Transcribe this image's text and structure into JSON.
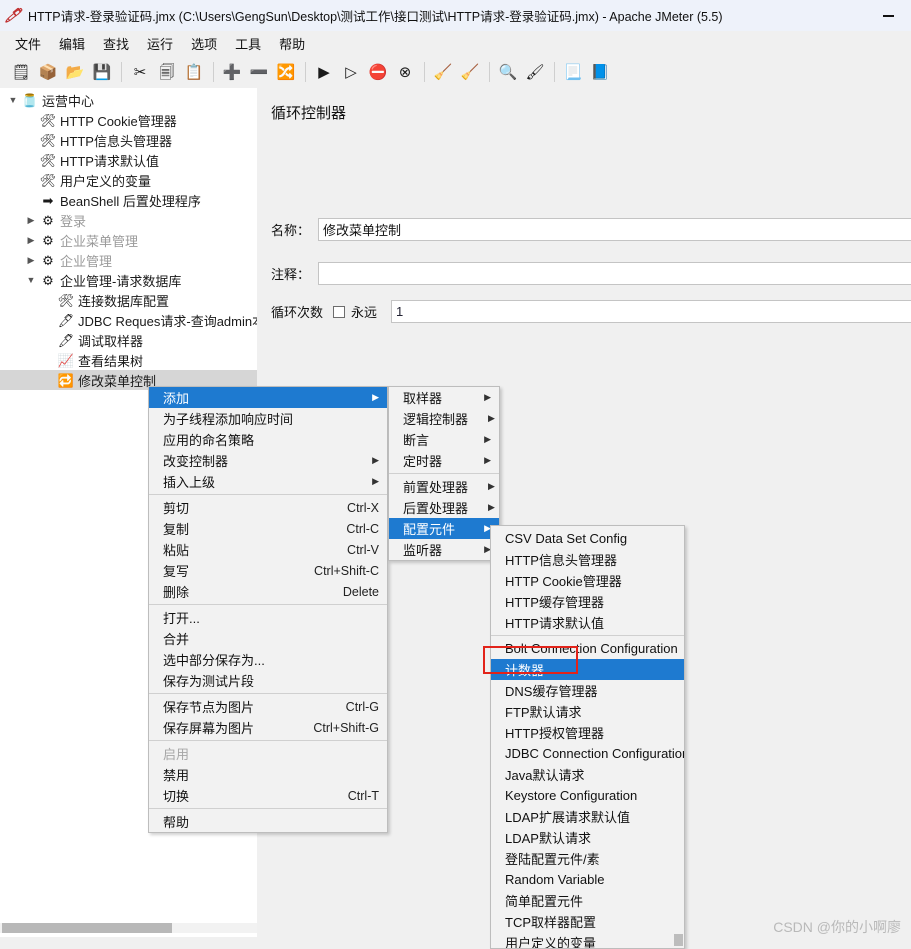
{
  "window": {
    "title": "HTTP请求-登录验证码.jmx (C:\\Users\\GengSun\\Desktop\\测试工作\\接口测试\\HTTP请求-登录验证码.jmx) - Apache JMeter (5.5)",
    "app_icon": "jmeter-feather-icon",
    "minimize_label": "—"
  },
  "menubar": {
    "items": [
      "文件",
      "编辑",
      "查找",
      "运行",
      "选项",
      "工具",
      "帮助"
    ]
  },
  "toolbar": {
    "buttons": [
      {
        "name": "new-test-plan",
        "glyph": "🗒"
      },
      {
        "name": "templates",
        "glyph": "📦"
      },
      {
        "name": "open",
        "glyph": "📂"
      },
      {
        "name": "save",
        "glyph": "💾"
      },
      {
        "sep": true
      },
      {
        "name": "cut",
        "glyph": "✂"
      },
      {
        "name": "copy",
        "glyph": "🗐"
      },
      {
        "name": "paste",
        "glyph": "📋"
      },
      {
        "sep": true
      },
      {
        "name": "expand-all",
        "glyph": "➕"
      },
      {
        "name": "collapse-all",
        "glyph": "➖"
      },
      {
        "name": "toggle",
        "glyph": "🔀"
      },
      {
        "sep": true
      },
      {
        "name": "start",
        "glyph": "▶"
      },
      {
        "name": "start-no-pauses",
        "glyph": "▷"
      },
      {
        "name": "stop",
        "glyph": "⛔"
      },
      {
        "name": "shutdown",
        "glyph": "⊗"
      },
      {
        "sep": true
      },
      {
        "name": "clear",
        "glyph": "🧹"
      },
      {
        "name": "clear-all",
        "glyph": "🧹"
      },
      {
        "sep": true
      },
      {
        "name": "search",
        "glyph": "🔍"
      },
      {
        "name": "reset-search",
        "glyph": "🖌"
      },
      {
        "sep": true
      },
      {
        "name": "function-helper",
        "glyph": "📃"
      },
      {
        "name": "help",
        "glyph": "📘"
      }
    ]
  },
  "tree": {
    "nodes": [
      {
        "label": "运营中心",
        "icon": "test-plan-icon",
        "indent": 0,
        "twist": "▼",
        "dim": false,
        "selected": false
      },
      {
        "label": "HTTP Cookie管理器",
        "icon": "config-element-icon",
        "indent": 1,
        "twist": "",
        "dim": false,
        "selected": false
      },
      {
        "label": "HTTP信息头管理器",
        "icon": "config-element-icon",
        "indent": 1,
        "twist": "",
        "dim": false,
        "selected": false
      },
      {
        "label": "HTTP请求默认值",
        "icon": "config-element-icon",
        "indent": 1,
        "twist": "",
        "dim": false,
        "selected": false
      },
      {
        "label": "用户定义的变量",
        "icon": "config-element-icon",
        "indent": 1,
        "twist": "",
        "dim": false,
        "selected": false
      },
      {
        "label": "BeanShell 后置处理程序",
        "icon": "post-processor-icon",
        "indent": 1,
        "twist": "",
        "dim": false,
        "selected": false
      },
      {
        "label": "登录",
        "icon": "controller-icon",
        "indent": 1,
        "twist": "▶",
        "dim": true,
        "selected": false
      },
      {
        "label": "企业菜单管理",
        "icon": "controller-icon",
        "indent": 1,
        "twist": "▶",
        "dim": true,
        "selected": false
      },
      {
        "label": "企业管理",
        "icon": "controller-icon",
        "indent": 1,
        "twist": "▶",
        "dim": true,
        "selected": false
      },
      {
        "label": "企业管理-请求数据库",
        "icon": "controller-active-icon",
        "indent": 1,
        "twist": "▼",
        "dim": false,
        "selected": false
      },
      {
        "label": "连接数据库配置",
        "icon": "config-element-icon",
        "indent": 2,
        "twist": "",
        "dim": false,
        "selected": false
      },
      {
        "label": "JDBC Reques请求-查询admin本|",
        "icon": "sampler-icon",
        "indent": 2,
        "twist": "",
        "dim": false,
        "selected": false
      },
      {
        "label": "调试取样器",
        "icon": "sampler-icon",
        "indent": 2,
        "twist": "",
        "dim": false,
        "selected": false
      },
      {
        "label": "查看结果树",
        "icon": "listener-icon",
        "indent": 2,
        "twist": "",
        "dim": false,
        "selected": false
      },
      {
        "label": "修改菜单控制",
        "icon": "loop-controller-icon",
        "indent": 2,
        "twist": "",
        "dim": false,
        "selected": true
      }
    ]
  },
  "detail": {
    "title": "循环控制器",
    "name_label": "名称：",
    "name_value": "修改菜单控制",
    "comment_label": "注释：",
    "comment_value": "",
    "loop_label": "循环次数",
    "forever_label": "永远",
    "forever_checked": false,
    "loop_value": "1"
  },
  "context_menu": {
    "items": [
      {
        "label": "添加",
        "accel": "",
        "arrow": true,
        "highlight": true,
        "disabled": false
      },
      {
        "label": "为子线程添加响应时间",
        "accel": "",
        "arrow": false,
        "highlight": false,
        "disabled": false
      },
      {
        "label": "应用的命名策略",
        "accel": "",
        "arrow": false,
        "highlight": false,
        "disabled": false
      },
      {
        "label": "改变控制器",
        "accel": "",
        "arrow": true,
        "highlight": false,
        "disabled": false
      },
      {
        "label": "插入上级",
        "accel": "",
        "arrow": true,
        "highlight": false,
        "disabled": false
      },
      {
        "sep": true
      },
      {
        "label": "剪切",
        "accel": "Ctrl-X",
        "arrow": false,
        "highlight": false,
        "disabled": false
      },
      {
        "label": "复制",
        "accel": "Ctrl-C",
        "arrow": false,
        "highlight": false,
        "disabled": false
      },
      {
        "label": "粘贴",
        "accel": "Ctrl-V",
        "arrow": false,
        "highlight": false,
        "disabled": false
      },
      {
        "label": "复写",
        "accel": "Ctrl+Shift-C",
        "arrow": false,
        "highlight": false,
        "disabled": false
      },
      {
        "label": "删除",
        "accel": "Delete",
        "arrow": false,
        "highlight": false,
        "disabled": false
      },
      {
        "sep": true
      },
      {
        "label": "打开...",
        "accel": "",
        "arrow": false,
        "highlight": false,
        "disabled": false
      },
      {
        "label": "合并",
        "accel": "",
        "arrow": false,
        "highlight": false,
        "disabled": false
      },
      {
        "label": "选中部分保存为...",
        "accel": "",
        "arrow": false,
        "highlight": false,
        "disabled": false
      },
      {
        "label": "保存为测试片段",
        "accel": "",
        "arrow": false,
        "highlight": false,
        "disabled": false
      },
      {
        "sep": true
      },
      {
        "label": "保存节点为图片",
        "accel": "Ctrl-G",
        "arrow": false,
        "highlight": false,
        "disabled": false
      },
      {
        "label": "保存屏幕为图片",
        "accel": "Ctrl+Shift-G",
        "arrow": false,
        "highlight": false,
        "disabled": false
      },
      {
        "sep": true
      },
      {
        "label": "启用",
        "accel": "",
        "arrow": false,
        "highlight": false,
        "disabled": true
      },
      {
        "label": "禁用",
        "accel": "",
        "arrow": false,
        "highlight": false,
        "disabled": false
      },
      {
        "label": "切换",
        "accel": "Ctrl-T",
        "arrow": false,
        "highlight": false,
        "disabled": false
      },
      {
        "sep": true
      },
      {
        "label": "帮助",
        "accel": "",
        "arrow": false,
        "highlight": false,
        "disabled": false
      }
    ]
  },
  "add_submenu": {
    "items": [
      {
        "label": "取样器",
        "arrow": true,
        "highlight": false
      },
      {
        "label": "逻辑控制器",
        "arrow": true,
        "highlight": false
      },
      {
        "label": "断言",
        "arrow": true,
        "highlight": false
      },
      {
        "label": "定时器",
        "arrow": true,
        "highlight": false
      },
      {
        "sep": true
      },
      {
        "label": "前置处理器",
        "arrow": true,
        "highlight": false
      },
      {
        "label": "后置处理器",
        "arrow": true,
        "highlight": false
      },
      {
        "label": "配置元件",
        "arrow": true,
        "highlight": true
      },
      {
        "label": "监听器",
        "arrow": true,
        "highlight": false
      }
    ]
  },
  "config_submenu": {
    "items": [
      {
        "label": "CSV Data Set Config",
        "highlight": false
      },
      {
        "label": "HTTP信息头管理器",
        "highlight": false
      },
      {
        "label": "HTTP Cookie管理器",
        "highlight": false
      },
      {
        "label": "HTTP缓存管理器",
        "highlight": false
      },
      {
        "label": "HTTP请求默认值",
        "highlight": false
      },
      {
        "sep": true
      },
      {
        "label": "Bolt Connection Configuration",
        "highlight": false
      },
      {
        "label": "计数器",
        "highlight": true
      },
      {
        "label": "DNS缓存管理器",
        "highlight": false
      },
      {
        "label": "FTP默认请求",
        "highlight": false
      },
      {
        "label": "HTTP授权管理器",
        "highlight": false
      },
      {
        "label": "JDBC Connection Configuration",
        "highlight": false
      },
      {
        "label": "Java默认请求",
        "highlight": false
      },
      {
        "label": "Keystore Configuration",
        "highlight": false
      },
      {
        "label": "LDAP扩展请求默认值",
        "highlight": false
      },
      {
        "label": "LDAP默认请求",
        "highlight": false
      },
      {
        "label": "登陆配置元件/素",
        "highlight": false
      },
      {
        "label": "Random Variable",
        "highlight": false
      },
      {
        "label": "简单配置元件",
        "highlight": false
      },
      {
        "label": "TCP取样器配置",
        "highlight": false
      },
      {
        "label": "用户定义的变量",
        "highlight": false
      }
    ]
  },
  "annotation": {
    "highlight_color": "#e2231a",
    "selection_color": "#1e7ad0"
  },
  "watermark": {
    "text": "CSDN @你的小啊廖"
  }
}
